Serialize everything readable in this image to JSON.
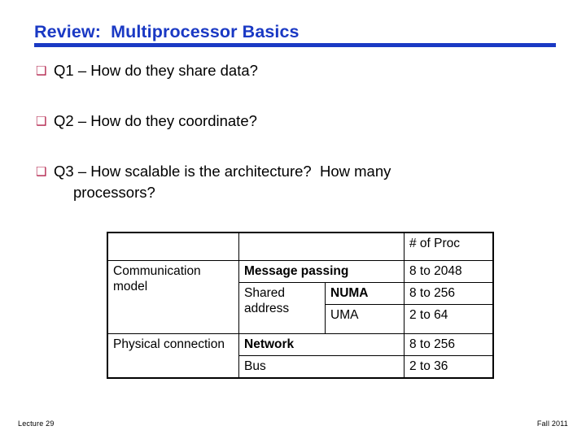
{
  "slide": {
    "title": "Review:  Multiprocessor Basics",
    "accent_color": "#b2214a",
    "title_color": "#1a39c4",
    "bullet_glyph": "❑"
  },
  "bullets": [
    {
      "marker": "❑",
      "text": "Q1 – How do they share data?"
    },
    {
      "marker": "❑",
      "text": "Q2 – How do they coordinate?"
    },
    {
      "marker": "❑",
      "text": "Q3 – How scalable is the architecture?  How many",
      "continuation": "processors?"
    }
  ],
  "table": {
    "header": {
      "blank1": "",
      "blank2": "",
      "count": "# of Proc"
    },
    "rows": [
      {
        "label": "Communication model",
        "item": "Message passing",
        "sub": "",
        "count": "8 to 2048",
        "accent": true
      },
      {
        "label": "",
        "item": "Shared address",
        "sub": "NUMA",
        "count": "8 to 256",
        "accent": true
      },
      {
        "label": "",
        "item": "",
        "sub": "UMA",
        "count": "2 to 64",
        "accent": false
      },
      {
        "label": "Physical connection",
        "item": "Network",
        "sub": "",
        "count": "8 to 256",
        "accent": true
      },
      {
        "label": "",
        "item": "Bus",
        "sub": "",
        "count": "2 to 36",
        "accent": false
      }
    ]
  },
  "footer": {
    "left": "Lecture 29",
    "right": "Fall 2011"
  }
}
